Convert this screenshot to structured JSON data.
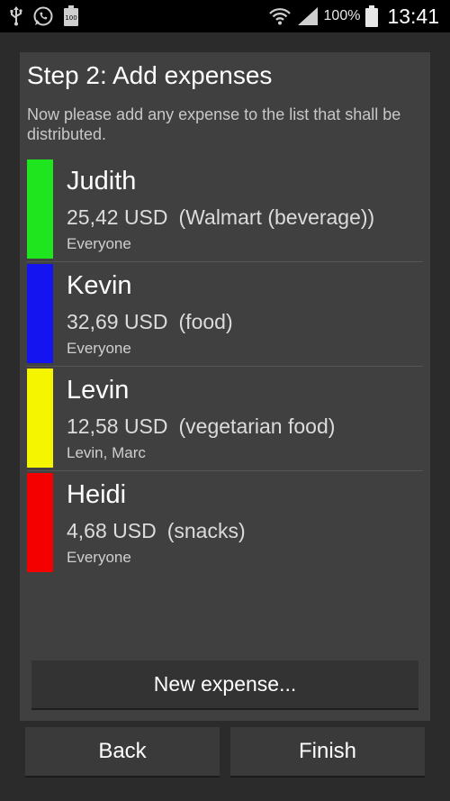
{
  "status_bar": {
    "battery_badge": "100",
    "battery_percent": "100%",
    "time": "13:41",
    "icons": [
      "usb-icon",
      "whatsapp-icon",
      "battery-small-icon",
      "wifi-icon",
      "signal-icon",
      "battery-icon"
    ]
  },
  "screen": {
    "title": "Step 2: Add expenses",
    "description": "Now please add any expense to the list that shall be distributed."
  },
  "expenses": [
    {
      "name": "Judith",
      "amount": "25,42 USD",
      "note": "(Walmart (beverage))",
      "participants": "Everyone",
      "color": "#1fe51f"
    },
    {
      "name": "Kevin",
      "amount": "32,69 USD",
      "note": "(food)",
      "participants": "Everyone",
      "color": "#1414f0"
    },
    {
      "name": "Levin",
      "amount": "12,58 USD",
      "note": "(vegetarian food)",
      "participants": "Levin, Marc",
      "color": "#f5f500"
    },
    {
      "name": "Heidi",
      "amount": "4,68 USD",
      "note": "(snacks)",
      "participants": "Everyone",
      "color": "#f50000"
    }
  ],
  "buttons": {
    "new_expense": "New expense...",
    "back": "Back",
    "finish": "Finish"
  }
}
